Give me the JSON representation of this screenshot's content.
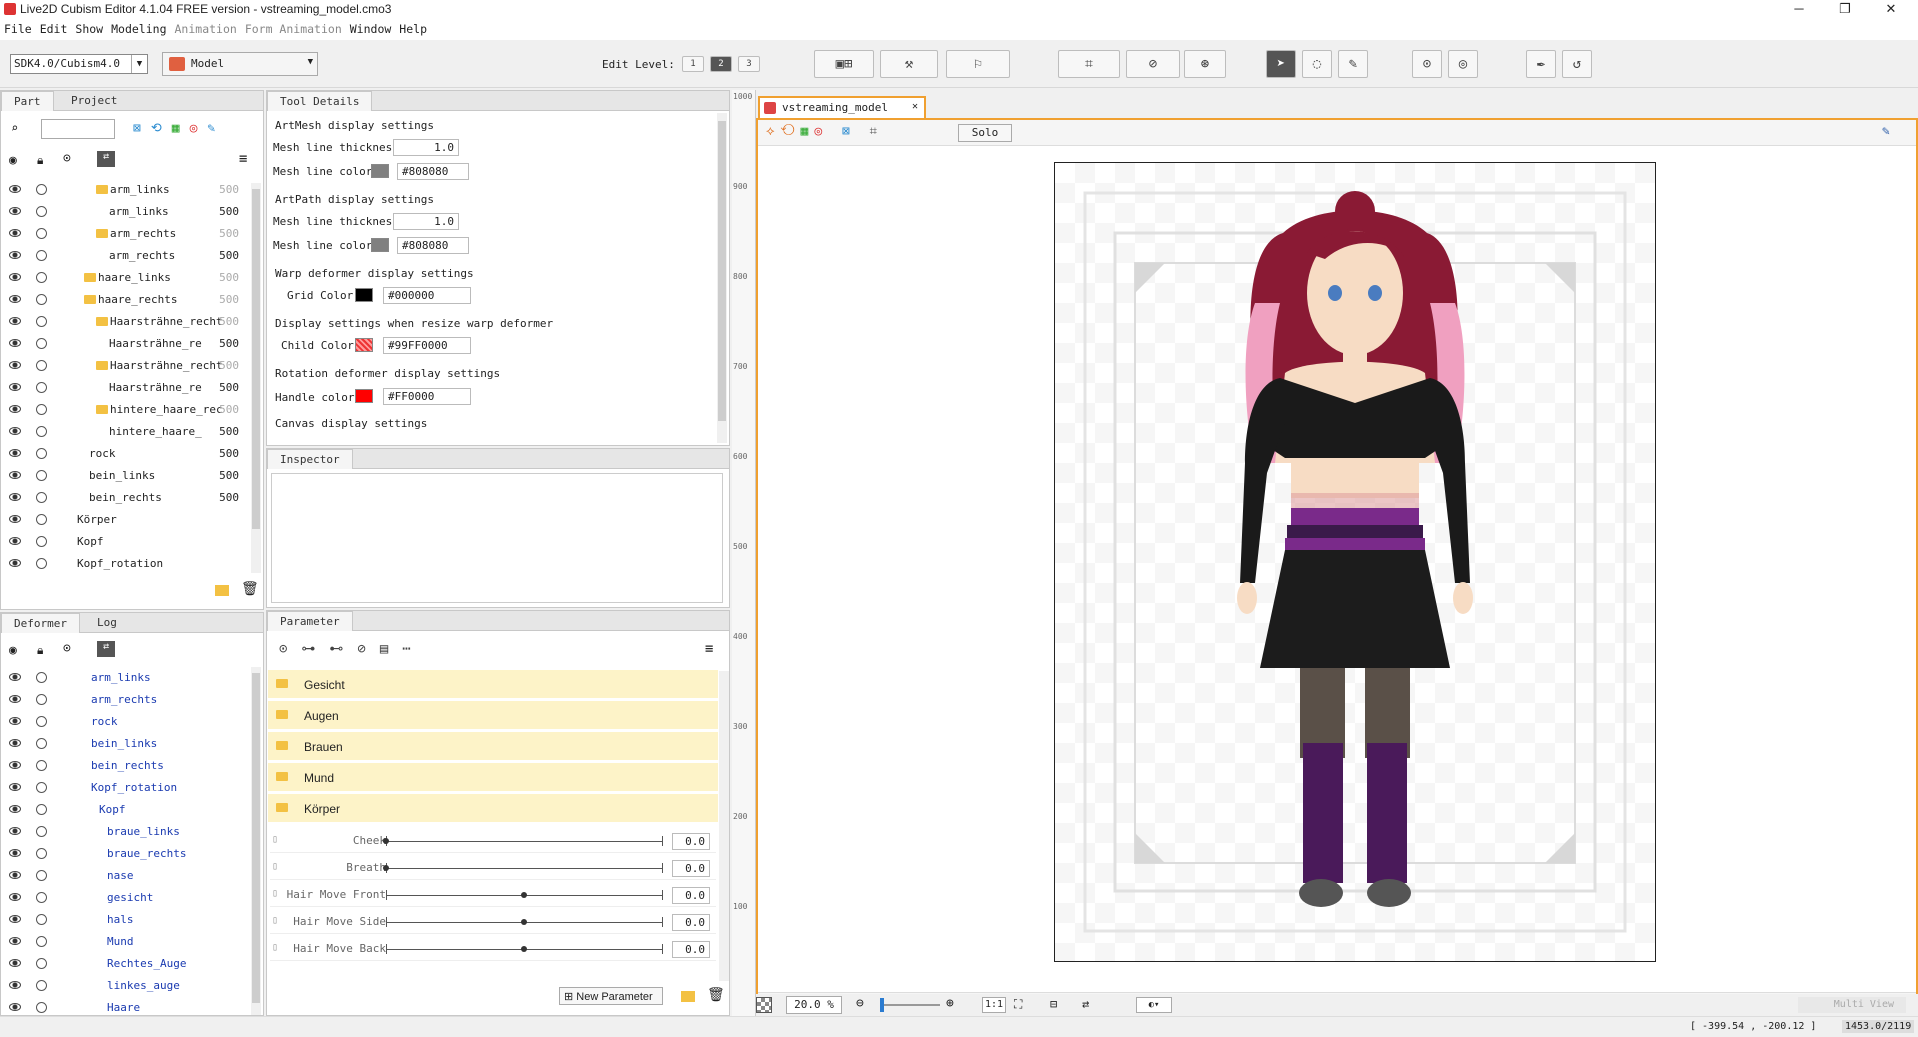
{
  "window": {
    "title": "Live2D Cubism Editor 4.1.04   FREE version  - vstreaming_model.cmo3"
  },
  "menu": [
    "File",
    "Edit",
    "Show",
    "Modeling",
    "Animation",
    "Form Animation",
    "Window",
    "Help"
  ],
  "toolbar": {
    "sdk": "SDK4.0/Cubism4.0",
    "mode": "Model",
    "edit_level_label": "Edit Level:",
    "levels": [
      "1",
      "2",
      "3"
    ]
  },
  "part_panel": {
    "tabs": [
      "Part",
      "Project"
    ],
    "rows": [
      {
        "label": "arm_links",
        "num": "500",
        "indent": 95,
        "dim": true,
        "folder": true
      },
      {
        "label": "arm_links",
        "num": "500",
        "indent": 108,
        "dim": false,
        "folder": false
      },
      {
        "label": "arm_rechts",
        "num": "500",
        "indent": 95,
        "dim": true,
        "folder": true
      },
      {
        "label": "arm_rechts",
        "num": "500",
        "indent": 108,
        "dim": false,
        "folder": false
      },
      {
        "label": "haare_links",
        "num": "500",
        "indent": 83,
        "dim": true,
        "folder": true
      },
      {
        "label": "haare_rechts",
        "num": "500",
        "indent": 83,
        "dim": true,
        "folder": true
      },
      {
        "label": "Haarsträhne_recht",
        "num": "500",
        "indent": 95,
        "dim": true,
        "folder": true
      },
      {
        "label": "Haarsträhne_re",
        "num": "500",
        "indent": 108,
        "dim": false,
        "folder": false
      },
      {
        "label": "Haarsträhne_recht",
        "num": "500",
        "indent": 95,
        "dim": true,
        "folder": true
      },
      {
        "label": "Haarsträhne_re",
        "num": "500",
        "indent": 108,
        "dim": false,
        "folder": false
      },
      {
        "label": "hintere_haare_rec",
        "num": "500",
        "indent": 95,
        "dim": true,
        "folder": true
      },
      {
        "label": "hintere_haare_",
        "num": "500",
        "indent": 108,
        "dim": false,
        "folder": false
      },
      {
        "label": "rock",
        "num": "500",
        "indent": 88,
        "dim": false,
        "folder": false
      },
      {
        "label": "bein_links",
        "num": "500",
        "indent": 88,
        "dim": false,
        "folder": false
      },
      {
        "label": "bein_rechts",
        "num": "500",
        "indent": 88,
        "dim": false,
        "folder": false
      },
      {
        "label": "Körper",
        "num": "",
        "indent": 76,
        "dim": false,
        "folder": false
      },
      {
        "label": "Kopf",
        "num": "",
        "indent": 76,
        "dim": false,
        "folder": false
      },
      {
        "label": "Kopf_rotation",
        "num": "",
        "indent": 76,
        "dim": false,
        "folder": false
      }
    ]
  },
  "deformer_panel": {
    "tabs": [
      "Deformer",
      "Log"
    ],
    "rows": [
      {
        "label": "arm_links",
        "indent": 90
      },
      {
        "label": "arm_rechts",
        "indent": 90
      },
      {
        "label": "rock",
        "indent": 90
      },
      {
        "label": "bein_links",
        "indent": 90
      },
      {
        "label": "bein_rechts",
        "indent": 90
      },
      {
        "label": "Kopf_rotation",
        "indent": 90
      },
      {
        "label": "Kopf",
        "indent": 98
      },
      {
        "label": "braue_links",
        "indent": 106
      },
      {
        "label": "braue_rechts",
        "indent": 106
      },
      {
        "label": "nase",
        "indent": 106
      },
      {
        "label": "gesicht",
        "indent": 106
      },
      {
        "label": "hals",
        "indent": 106
      },
      {
        "label": "Mund",
        "indent": 106
      },
      {
        "label": "Rechtes_Auge",
        "indent": 106
      },
      {
        "label": "linkes_auge",
        "indent": 106
      },
      {
        "label": "Haare",
        "indent": 106
      }
    ]
  },
  "tool_details": {
    "tab": "Tool Details",
    "artmesh_title": "ArtMesh display settings",
    "mesh_thickness_label": "Mesh line thickness",
    "mesh_thickness": "1.0",
    "mesh_color_label": "Mesh line color",
    "mesh_color": "#808080",
    "artpath_title": "ArtPath display settings",
    "path_thickness_label": "Mesh line thickness",
    "path_thickness": "1.0",
    "path_color_label": "Mesh line color",
    "path_color": "#808080",
    "warp_title": "Warp deformer display settings",
    "grid_color_label": "Grid Color",
    "grid_color": "#000000",
    "resize_title": "Display settings when resize warp deformer",
    "child_color_label": "Child Color",
    "child_color": "#99FF0000",
    "rotation_title": "Rotation deformer display settings",
    "handle_color_label": "Handle color",
    "handle_color": "#FF0000",
    "canvas_title": "Canvas display settings"
  },
  "inspector": {
    "tab": "Inspector"
  },
  "parameter": {
    "tab": "Parameter",
    "groups": [
      "Gesicht",
      "Augen",
      "Brauen",
      "Mund",
      "Körper"
    ],
    "params": [
      {
        "label": "Cheek",
        "value": "0.0",
        "pos": 0.0
      },
      {
        "label": "Breath",
        "value": "0.0",
        "pos": 0.0
      },
      {
        "label": "Hair Move Front",
        "value": "0.0",
        "pos": 0.5
      },
      {
        "label": "Hair Move Side",
        "value": "0.0",
        "pos": 0.5
      },
      {
        "label": "Hair Move Back",
        "value": "0.0",
        "pos": 0.5
      }
    ],
    "new_param": "New Parameter"
  },
  "ruler": [
    "1000",
    "900",
    "800",
    "700",
    "600",
    "500",
    "400",
    "300",
    "200",
    "100"
  ],
  "viewer": {
    "tab": "vstreaming_model",
    "solo": "Solo",
    "zoom": "20.0 %",
    "ratio": "1:1",
    "multi_view": "Multi View"
  },
  "status": {
    "coords": "[ -399.54 , -200.12 ]",
    "size": "1453.0/2119"
  }
}
